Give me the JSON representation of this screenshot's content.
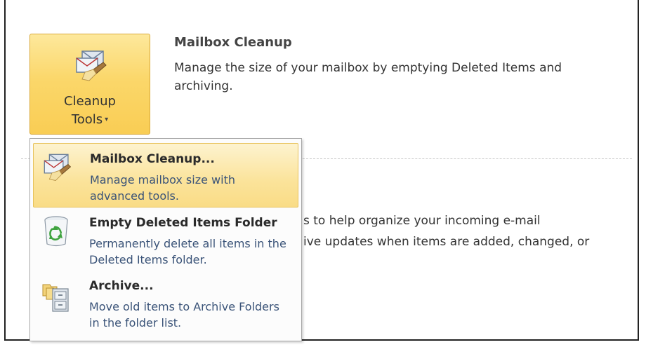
{
  "section": {
    "button_label_line1": "Cleanup",
    "button_label_line2": "Tools",
    "caret": "▾",
    "title": "Mailbox Cleanup",
    "description": "Manage the size of your mailbox by emptying Deleted Items and archiving."
  },
  "obscured": {
    "line1": "s to help organize your incoming e-mail",
    "line2": "ive updates when items are added, changed, or"
  },
  "menu": {
    "items": [
      {
        "title": "Mailbox Cleanup...",
        "description": "Manage mailbox size with advanced tools.",
        "icon": "mailbox-cleanup-icon",
        "highlighted": true
      },
      {
        "title": "Empty Deleted Items Folder",
        "description": "Permanently delete all items in the Deleted Items folder.",
        "icon": "recycle-bin-icon",
        "highlighted": false
      },
      {
        "title": "Archive...",
        "description": "Move old items to Archive Folders in the folder list.",
        "icon": "archive-cabinet-icon",
        "highlighted": false
      }
    ]
  },
  "colors": {
    "button_fill": "#fbd76a",
    "highlight_fill": "#fbe39a",
    "description_text": "#3a5378"
  }
}
